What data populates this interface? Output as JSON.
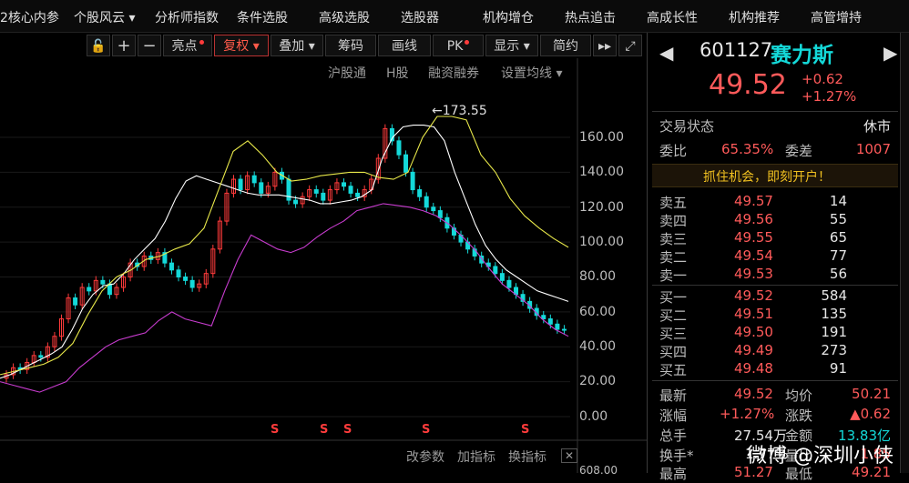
{
  "nav": [
    {
      "label": "2核心内参"
    },
    {
      "label": "个股风云 ▾"
    },
    {
      "label": "分析师指数"
    },
    {
      "label": "条件选股"
    },
    {
      "label": "高级选股"
    },
    {
      "label": "选股器"
    },
    {
      "label": "机构增仓"
    },
    {
      "label": "热点追击"
    },
    {
      "label": "高成长性"
    },
    {
      "label": "机构推荐"
    },
    {
      "label": "高管增持"
    }
  ],
  "toolbar": {
    "lock": "🔓",
    "plus": "+",
    "minus": "−",
    "liangdian": "亮点",
    "fuquan": "复权 ▾",
    "diejia": "叠加 ▾",
    "chouma": "筹码",
    "huaxian": "画线",
    "pk": "PK",
    "xianshi": "显示 ▾",
    "jianyue": "简约",
    "next": "▸▸",
    "expand": "⤢"
  },
  "sublinks": {
    "hgt": "沪股通",
    "hgu": "H股",
    "rzrq": "融资融券",
    "ma": "设置均线 ▾"
  },
  "chart_data": {
    "type": "line",
    "peak_label": "173.55",
    "y_ticks": [
      "160.00",
      "140.00",
      "120.00",
      "100.00",
      "80.00",
      "60.00",
      "40.00",
      "20.00",
      "0.00"
    ],
    "ylim": [
      0,
      180
    ],
    "bottom_partial": "608.00",
    "signal_marker": "S",
    "series": [
      {
        "values": [
          22,
          24,
          27,
          30,
          33,
          36,
          40,
          50,
          62,
          70,
          75,
          76,
          82,
          90,
          96,
          102,
          112,
          125,
          135,
          138,
          136,
          134,
          132,
          130,
          128,
          127,
          127,
          127,
          126,
          125,
          124,
          122,
          122,
          123,
          124,
          126,
          130,
          148,
          160,
          166,
          167,
          167,
          166,
          158,
          140,
          125,
          110,
          98,
          90,
          84,
          80,
          76,
          72,
          70,
          68,
          66
        ]
      },
      {
        "values": [
          24,
          26,
          28,
          30,
          34,
          42,
          58,
          72,
          80,
          84,
          90,
          92,
          96,
          99,
          108,
          130,
          152,
          158,
          150,
          140,
          135,
          136,
          138,
          139,
          140,
          140,
          137,
          136,
          140,
          160,
          172,
          172,
          170,
          150,
          140,
          125,
          115,
          108,
          102,
          97
        ]
      },
      {
        "values": [
          20,
          18,
          16,
          14,
          17,
          20,
          28,
          34,
          40,
          44,
          46,
          48,
          55,
          60,
          56,
          54,
          52,
          72,
          90,
          104,
          100,
          96,
          94,
          97,
          103,
          108,
          112,
          118,
          120,
          122,
          121,
          120,
          118,
          115,
          110,
          103,
          95,
          85,
          76,
          70,
          64,
          56,
          50,
          46
        ]
      },
      {
        "values": [
          16,
          13,
          12,
          14,
          18,
          25,
          35,
          45,
          55,
          62,
          68,
          70,
          72,
          74,
          80,
          90,
          100,
          108,
          114,
          117,
          118,
          118,
          119,
          120,
          122,
          123,
          122,
          120,
          118,
          116,
          112,
          108,
          104,
          98,
          92,
          86,
          80,
          74,
          66,
          58
        ]
      }
    ],
    "candles": [
      {
        "o": 22,
        "c": 24
      },
      {
        "o": 24,
        "c": 28
      },
      {
        "o": 28,
        "c": 27
      },
      {
        "o": 27,
        "c": 31
      },
      {
        "o": 31,
        "c": 35
      },
      {
        "o": 35,
        "c": 34
      },
      {
        "o": 34,
        "c": 40
      },
      {
        "o": 40,
        "c": 46
      },
      {
        "o": 46,
        "c": 56
      },
      {
        "o": 56,
        "c": 68
      },
      {
        "o": 68,
        "c": 64
      },
      {
        "o": 64,
        "c": 74
      },
      {
        "o": 74,
        "c": 72
      },
      {
        "o": 72,
        "c": 78
      },
      {
        "o": 78,
        "c": 76
      },
      {
        "o": 76,
        "c": 70
      },
      {
        "o": 70,
        "c": 74
      },
      {
        "o": 74,
        "c": 80
      },
      {
        "o": 80,
        "c": 88
      },
      {
        "o": 88,
        "c": 86
      },
      {
        "o": 86,
        "c": 92
      },
      {
        "o": 92,
        "c": 90
      },
      {
        "o": 90,
        "c": 94
      },
      {
        "o": 94,
        "c": 88
      },
      {
        "o": 88,
        "c": 84
      },
      {
        "o": 84,
        "c": 80
      },
      {
        "o": 80,
        "c": 78
      },
      {
        "o": 78,
        "c": 74
      },
      {
        "o": 74,
        "c": 76
      },
      {
        "o": 76,
        "c": 82
      },
      {
        "o": 82,
        "c": 96
      },
      {
        "o": 96,
        "c": 112
      },
      {
        "o": 112,
        "c": 128
      },
      {
        "o": 128,
        "c": 136
      },
      {
        "o": 136,
        "c": 130
      },
      {
        "o": 130,
        "c": 138
      },
      {
        "o": 138,
        "c": 134
      },
      {
        "o": 134,
        "c": 128
      },
      {
        "o": 128,
        "c": 132
      },
      {
        "o": 132,
        "c": 140
      },
      {
        "o": 140,
        "c": 136
      },
      {
        "o": 136,
        "c": 124
      },
      {
        "o": 124,
        "c": 122
      },
      {
        "o": 122,
        "c": 126
      },
      {
        "o": 126,
        "c": 130
      },
      {
        "o": 130,
        "c": 128
      },
      {
        "o": 128,
        "c": 124
      },
      {
        "o": 124,
        "c": 130
      },
      {
        "o": 130,
        "c": 134
      },
      {
        "o": 134,
        "c": 132
      },
      {
        "o": 132,
        "c": 128
      },
      {
        "o": 128,
        "c": 126
      },
      {
        "o": 126,
        "c": 130
      },
      {
        "o": 130,
        "c": 136
      },
      {
        "o": 136,
        "c": 148
      },
      {
        "o": 148,
        "c": 165
      },
      {
        "o": 165,
        "c": 158
      },
      {
        "o": 158,
        "c": 150
      },
      {
        "o": 150,
        "c": 140
      },
      {
        "o": 140,
        "c": 130
      },
      {
        "o": 130,
        "c": 126
      },
      {
        "o": 126,
        "c": 120
      },
      {
        "o": 120,
        "c": 118
      },
      {
        "o": 118,
        "c": 114
      },
      {
        "o": 114,
        "c": 108
      },
      {
        "o": 108,
        "c": 104
      },
      {
        "o": 104,
        "c": 100
      },
      {
        "o": 100,
        "c": 96
      },
      {
        "o": 96,
        "c": 92
      },
      {
        "o": 92,
        "c": 88
      },
      {
        "o": 88,
        "c": 86
      },
      {
        "o": 86,
        "c": 82
      },
      {
        "o": 82,
        "c": 78
      },
      {
        "o": 78,
        "c": 74
      },
      {
        "o": 74,
        "c": 70
      },
      {
        "o": 70,
        "c": 66
      },
      {
        "o": 66,
        "c": 62
      },
      {
        "o": 62,
        "c": 58
      },
      {
        "o": 58,
        "c": 56
      },
      {
        "o": 56,
        "c": 53
      },
      {
        "o": 53,
        "c": 50
      },
      {
        "o": 50,
        "c": 49.52
      }
    ]
  },
  "bottom": {
    "params": "改参数",
    "add": "加指标",
    "switch": "换指标"
  },
  "stock": {
    "code": "601127",
    "name": "赛力斯",
    "price": "49.52",
    "change": "+0.62",
    "change_pct": "+1.27%",
    "status_label": "交易状态",
    "status_value": "休市",
    "weibi_label": "委比",
    "weibi_value": "65.35%",
    "weicha_label": "委差",
    "weicha_value": "1007",
    "banner": "抓住机会，即刻开户！",
    "asks": [
      {
        "label": "卖五",
        "price": "49.57",
        "vol": "14"
      },
      {
        "label": "卖四",
        "price": "49.56",
        "vol": "55"
      },
      {
        "label": "卖三",
        "price": "49.55",
        "vol": "65"
      },
      {
        "label": "卖二",
        "price": "49.54",
        "vol": "77"
      },
      {
        "label": "卖一",
        "price": "49.53",
        "vol": "56"
      }
    ],
    "bids": [
      {
        "label": "买一",
        "price": "49.52",
        "vol": "584"
      },
      {
        "label": "买二",
        "price": "49.51",
        "vol": "135"
      },
      {
        "label": "买三",
        "price": "49.50",
        "vol": "191"
      },
      {
        "label": "买四",
        "price": "49.49",
        "vol": "273"
      },
      {
        "label": "买五",
        "price": "49.48",
        "vol": "91"
      }
    ],
    "latest_label": "最新",
    "latest": "49.52",
    "avg_label": "均价",
    "avg": "50.21",
    "zf_label": "涨幅",
    "zf": "+1.27%",
    "zd_label": "涨跌",
    "zd": "▲0.62",
    "zs_label": "总手",
    "zs": "27.54万",
    "je_label": "金额",
    "je": "13.83亿",
    "hs_label": "换手*",
    "hs": "1.77%",
    "lb_label": "量比",
    "lb": "1.85",
    "zg_label": "最高",
    "zg": "51.27",
    "zd2_label": "最低",
    "zd2": "49.21"
  },
  "watermark": "微博 @深圳小侠"
}
